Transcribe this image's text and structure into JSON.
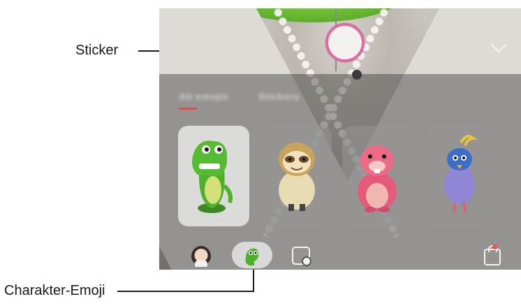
{
  "callouts": {
    "sticker": "Sticker",
    "character_emoji": "Charakter-Emoji"
  },
  "tabs": [
    {
      "label": "All emojis"
    },
    {
      "label": "Stickers"
    }
  ],
  "emoji_cards": [
    {
      "name": "green dinosaur",
      "selected": true
    },
    {
      "name": "sloth",
      "selected": false
    },
    {
      "name": "pink beaver",
      "selected": false
    },
    {
      "name": "blue bird",
      "selected": false
    }
  ],
  "colors": {
    "capture_ring": "#e06aa0",
    "tab_indicator": "#e24a4a",
    "notification_badge": "#ff4a4a"
  },
  "bottom_bar": {
    "icons": [
      "my-emoji-avatar-icon",
      "character-emoji-icon",
      "face-settings-icon",
      "store-bag-icon"
    ]
  }
}
